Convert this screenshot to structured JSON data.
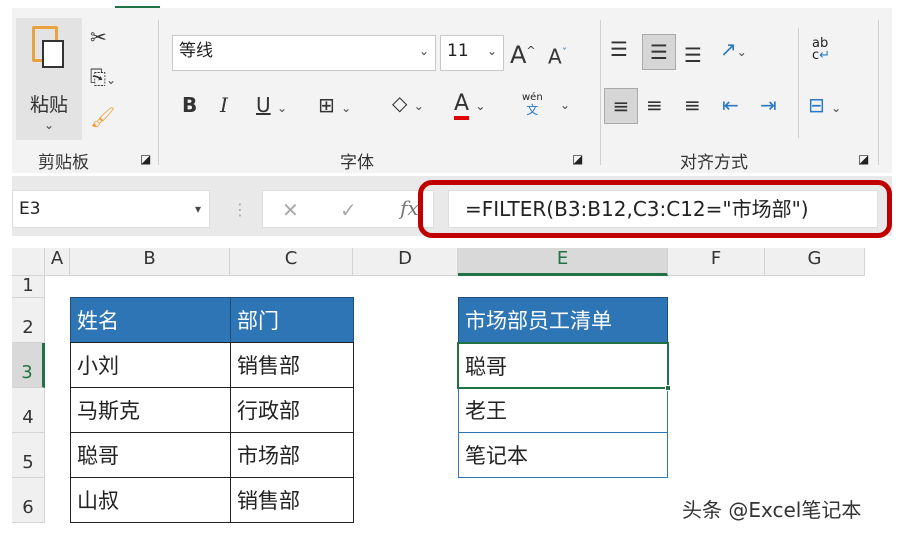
{
  "ribbon": {
    "clipboard": {
      "paste": "粘贴",
      "group": "剪贴板"
    },
    "font": {
      "name": "等线",
      "size": "11",
      "bold": "B",
      "italic": "I",
      "underline": "U",
      "font_color": "A",
      "phonetic_top": "wén",
      "phonetic_bottom": "文",
      "group": "字体",
      "grow": "A",
      "shrink": "A"
    },
    "alignment": {
      "group": "对齐方式",
      "wrap_top": "ab",
      "wrap_bottom": "c"
    }
  },
  "formula_bar": {
    "name_box": "E3",
    "cancel": "✕",
    "enter": "✓",
    "fx": "fx",
    "formula": "=FILTER(B3:B12,C3:C12=\"市场部\")",
    "highlight_color": "#c00000"
  },
  "columns": [
    "A",
    "B",
    "C",
    "D",
    "E",
    "F",
    "G"
  ],
  "rows": [
    "1",
    "2",
    "3",
    "4",
    "5",
    "6"
  ],
  "table": {
    "headers": [
      "姓名",
      "部门"
    ],
    "rows": [
      [
        "小刘",
        "销售部"
      ],
      [
        "马斯克",
        "行政部"
      ],
      [
        "聪哥",
        "市场部"
      ],
      [
        "山叔",
        "销售部"
      ]
    ]
  },
  "result": {
    "header": "市场部员工清单",
    "values": [
      "聪哥",
      "老王",
      "笔记本"
    ]
  },
  "watermark": "头条 @Excel笔记本"
}
